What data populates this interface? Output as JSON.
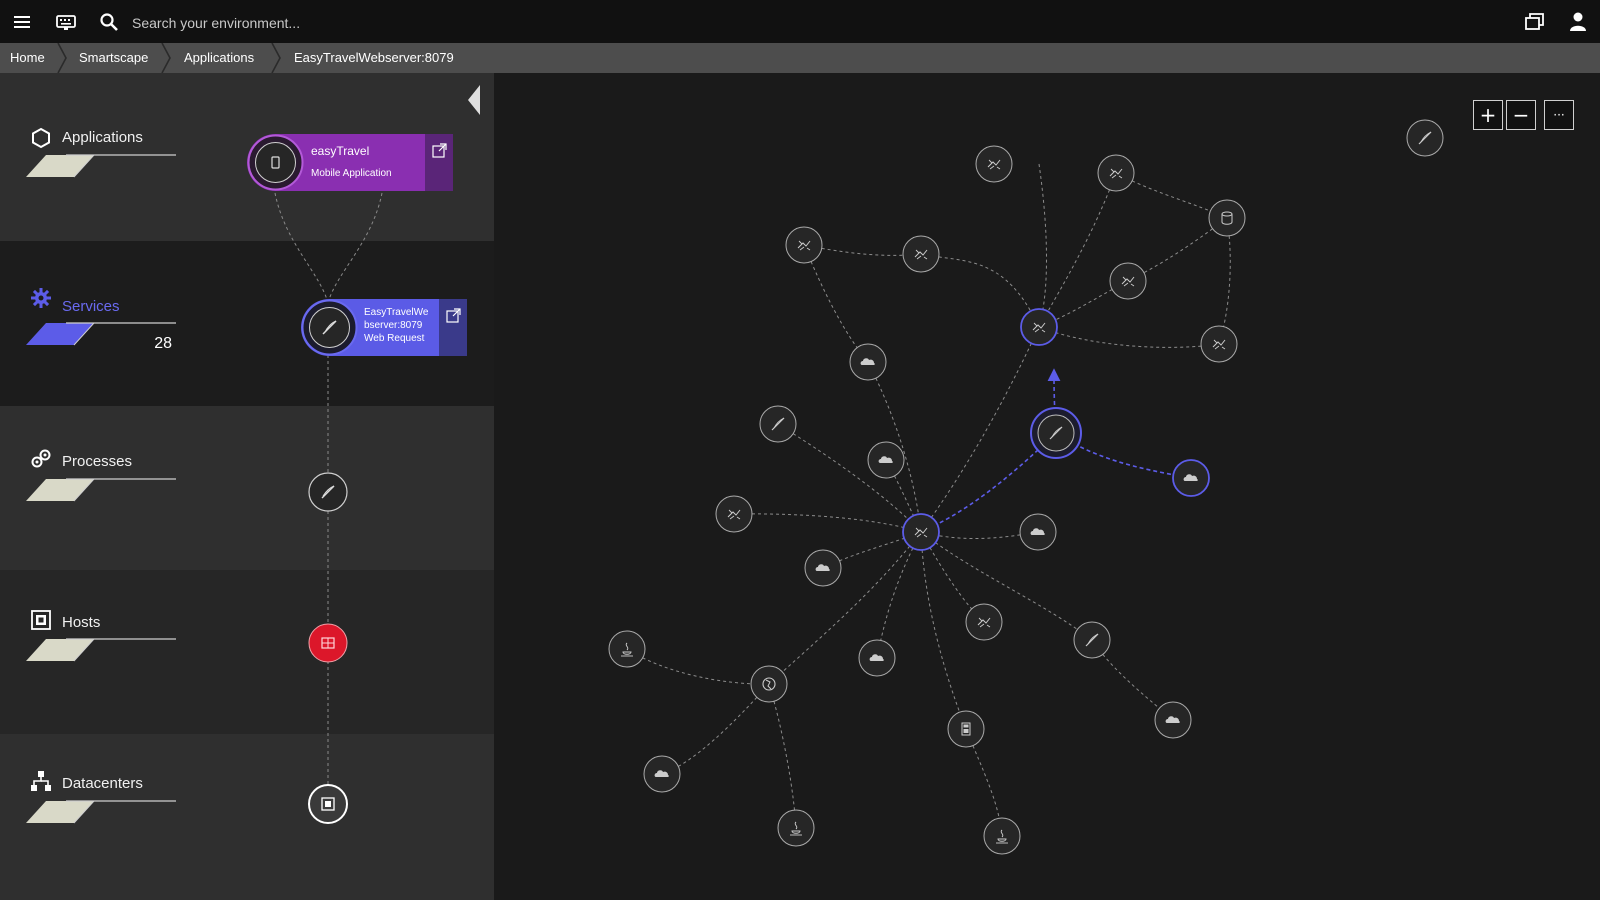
{
  "topbar": {
    "menu_icon": "hamburger-menu-icon",
    "chat_icon": "keyboard-icon",
    "search_icon": "search-icon",
    "search_placeholder": "Search your environment...",
    "windows_icon": "windows-icon",
    "user_icon": "user-icon"
  },
  "breadcrumb": {
    "items": [
      {
        "label": "Home"
      },
      {
        "label": "Smartscape"
      },
      {
        "label": "Applications"
      },
      {
        "label": "EasyTravelWebserver:8079"
      }
    ]
  },
  "layers": {
    "applications": {
      "label": "Applications",
      "icon": "applications-icon"
    },
    "services": {
      "label": "Services",
      "count": "28",
      "icon": "gear-icon",
      "accent": "#5c5ce8"
    },
    "processes": {
      "label": "Processes",
      "icon": "processes-icon"
    },
    "hosts": {
      "label": "Hosts",
      "icon": "host-icon"
    },
    "datacenters": {
      "label": "Datacenters",
      "icon": "datacenter-icon"
    }
  },
  "cards": {
    "application": {
      "title": "easyTravel",
      "subtitle": "Mobile Application",
      "color": "#8a2fb1",
      "icon": "mobile-icon"
    },
    "service": {
      "title_line1": "EasyTravelWe",
      "title_line2": "bserver:8079",
      "subtitle": "Web Request",
      "color": "#5b5be6",
      "icon": "feather-icon"
    }
  },
  "colors": {
    "host_alert": "#dc172a",
    "highlight": "#5c5ce8"
  },
  "graph": {
    "zoom_in": "+",
    "zoom_out": "−",
    "more": "···"
  }
}
